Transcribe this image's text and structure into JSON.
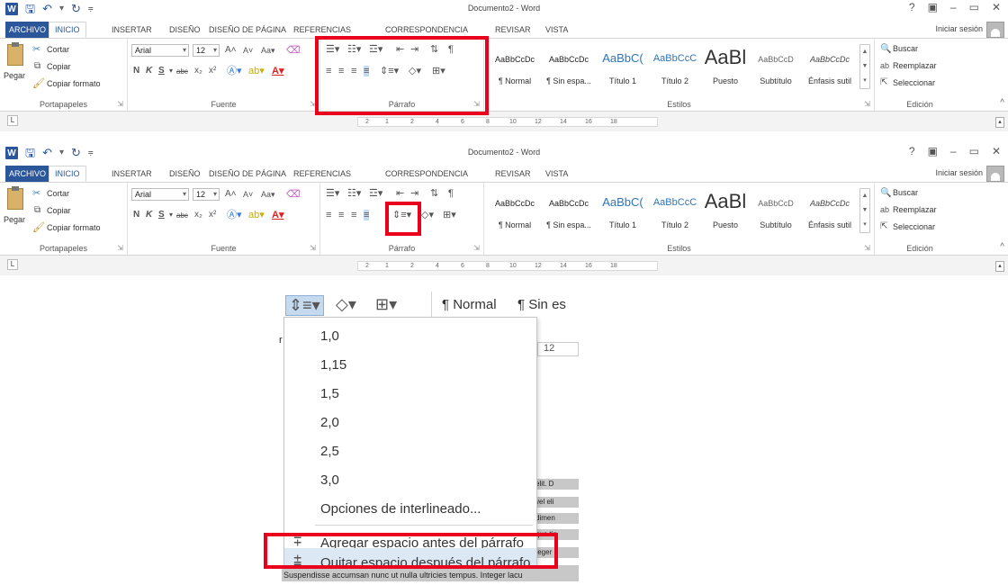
{
  "window": {
    "title": "Documento2 - Word",
    "controls": [
      "?",
      "▣",
      "–",
      "▭",
      "✕"
    ]
  },
  "tabs": [
    "ARCHIVO",
    "INICIO",
    "INSERTAR",
    "DISEÑO",
    "DISEÑO DE PÁGINA",
    "REFERENCIAS",
    "CORRESPONDENCIA",
    "REVISAR",
    "VISTA"
  ],
  "signin": "Iniciar sesión",
  "portapapeles": {
    "paste": "Pegar",
    "cut": "Cortar",
    "copy": "Copiar",
    "format_painter": "Copiar formato",
    "label": "Portapapeles"
  },
  "fuente": {
    "font": "Arial",
    "size": "12",
    "label": "Fuente"
  },
  "parrafo": {
    "label": "Párrafo"
  },
  "estilos": {
    "label": "Estilos",
    "items": [
      {
        "sample": "AaBbCcDc",
        "name": "¶ Normal"
      },
      {
        "sample": "AaBbCcDc",
        "name": "¶ Sin espa..."
      },
      {
        "sample": "AaBbC(",
        "name": "Título 1"
      },
      {
        "sample": "AaBbCcC",
        "name": "Título 2"
      },
      {
        "sample": "AaBl",
        "name": "Puesto"
      },
      {
        "sample": "AaBbCcD",
        "name": "Subtítulo"
      },
      {
        "sample": "AaBbCcDc",
        "name": "Énfasis sutil"
      }
    ]
  },
  "edicion": {
    "find": "Buscar",
    "replace": "Reemplazar",
    "select": "Seleccionar",
    "label": "Edición"
  },
  "ruler_labels": [
    "2",
    "1",
    "2",
    "4",
    "6",
    "8",
    "10",
    "12",
    "14",
    "16",
    "18"
  ],
  "zoom": {
    "normal": "¶ Normal",
    "sin": "¶ Sin es",
    "ruler_num": "12",
    "left_char": "r",
    "menu": [
      "1,0",
      "1,15",
      "1,5",
      "2,0",
      "2,5",
      "3,0",
      "Opciones de interlineado...",
      "Agregar espacio antes del párrafo",
      "Quitar espacio después del párrafo"
    ],
    "bg_lines": [
      "elit. D",
      "vel eli",
      "dimen",
      "que tin",
      "teger",
      "nis"
    ],
    "bottom_text": "Suspendisse accumsan nunc ut nulla ultricies tempus. Integer lacu"
  },
  "colors": {
    "accent": "#2b579a",
    "highlight": "#e8001c",
    "hover": "#dce8f4"
  }
}
